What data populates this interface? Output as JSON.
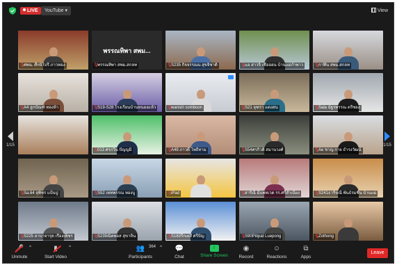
{
  "topbar": {
    "live_label": "LIVE",
    "stream_label": "YouTube ▾",
    "view_label": "View"
  },
  "navigation": {
    "left_page": "1/15",
    "right_page": "1/15"
  },
  "participants_grid": [
    {
      "name": "ศพน. ศึกษิโปรี ภาวทอง",
      "muted": true,
      "active": true
    },
    {
      "name": "พรรณทิพา สพม.สกลท",
      "muted": true,
      "bigname": "พรรณทิพา สพม..."
    },
    {
      "name": "S235 กิจจรรณน สุขจิชาติ",
      "muted": true
    },
    {
      "name": "แอ สาวจิ๋ เชื่อออน บ้านแม่กำพาว",
      "muted": true
    },
    {
      "name": "กาฬิน สพม.สกลท",
      "muted": true
    },
    {
      "name": "A4 ลูกบัณฑ์ ทองห้า",
      "muted": true
    },
    {
      "name": "S19-S28 โรงเรียนบ้านหนองแห้ว",
      "muted": true
    },
    {
      "name": "wansiri somboon",
      "muted": true
    },
    {
      "name": "S21 จุฑรา แดงสน",
      "muted": true
    },
    {
      "name": "Sala นัฐรพรรณ ตรีซอง",
      "muted": true
    },
    {
      "name": "",
      "muted": false
    },
    {
      "name": "013 ศรกวิน ปัญญมิ",
      "muted": true
    },
    {
      "name": "A49 ภาวดี โพธิ์ทาม",
      "muted": true
    },
    {
      "name": "S54ศรกิวติ สมานวงศ์",
      "muted": true
    },
    {
      "name": "Ae ชาญ กาย ธำรงวัฒน์",
      "muted": true
    },
    {
      "name": "Sa.64 สุพิชร แป้นปู",
      "muted": true
    },
    {
      "name": "S52 เททพรรณ ทองบู",
      "muted": true
    },
    {
      "name": "iPad",
      "muted": true
    },
    {
      "name": "สาริณี มีแพทเวด รร.ศรีสำเนียง",
      "muted": true
    },
    {
      "name": "S241ธาริขณี พันธ์รมชื่น บ้านแม่",
      "muted": true
    },
    {
      "name": "S225 ลาบาจารุต เรืองเพ็ชร",
      "muted": true
    },
    {
      "name": "S239ณิตพอส สุขาถิน",
      "muted": true
    },
    {
      "name": "S183รีกเยสี ศรีปัญ",
      "muted": true
    },
    {
      "name": "S90Pitipat Luepong",
      "muted": true
    },
    {
      "name": "Zothong",
      "muted": true
    }
  ],
  "toolbar": {
    "unmute": "Unmute",
    "stop_video": "Start Video",
    "participants": "Participants",
    "participants_count": "364",
    "chat": "Chat",
    "share_screen": "Share Screen",
    "record": "Record",
    "reactions": "Reactions",
    "apps": "Apps",
    "leave": "Leave"
  },
  "colors": {
    "accent_blue": "#2d8cff",
    "live_red": "#d32f2f",
    "share_green": "#22c55e",
    "leave_red": "#e02828",
    "active_speaker": "#e6e600"
  }
}
